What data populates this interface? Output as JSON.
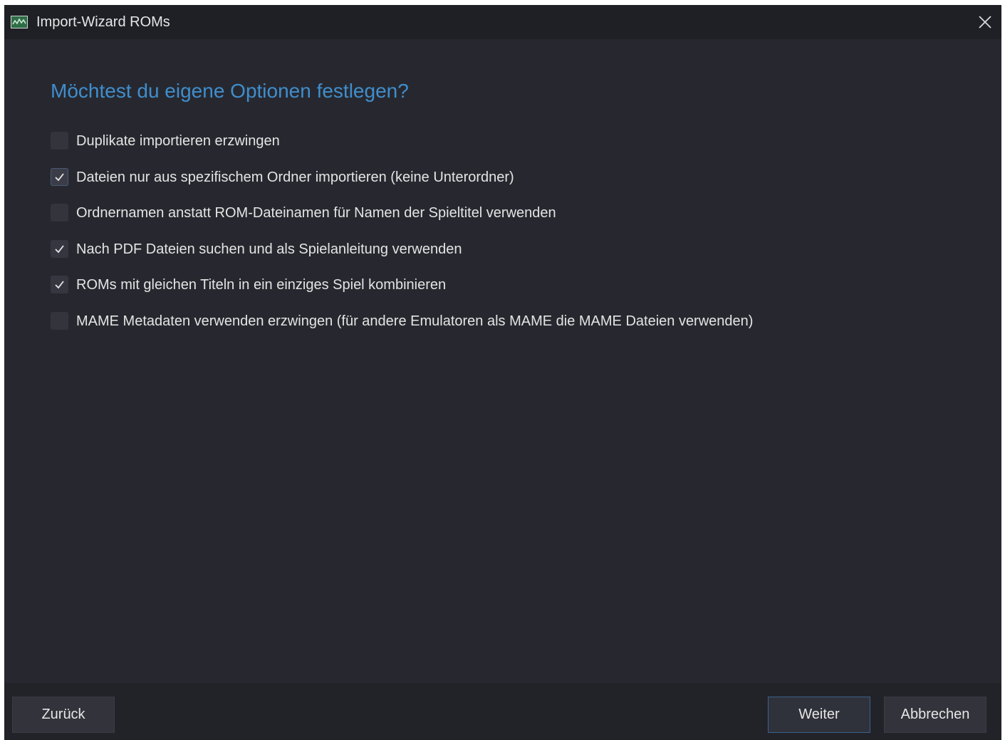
{
  "window": {
    "title": "Import-Wizard ROMs",
    "icon": "app-icon"
  },
  "page": {
    "heading": "Möchtest du eigene Optionen festlegen?"
  },
  "options": [
    {
      "label": "Duplikate importieren erzwingen",
      "checked": false
    },
    {
      "label": "Dateien nur aus spezifischem Ordner importieren (keine Unterordner)",
      "checked": true,
      "focused": true
    },
    {
      "label": "Ordnernamen anstatt ROM-Dateinamen für Namen der Spieltitel verwenden",
      "checked": false
    },
    {
      "label": "Nach PDF Dateien suchen und als Spielanleitung verwenden",
      "checked": true
    },
    {
      "label": "ROMs mit gleichen Titeln in ein einziges Spiel kombinieren",
      "checked": true
    },
    {
      "label": "MAME Metadaten verwenden erzwingen (für andere Emulatoren als MAME die MAME Dateien verwenden)",
      "checked": false
    }
  ],
  "footer": {
    "back_label": "Zurück",
    "next_label": "Weiter",
    "cancel_label": "Abbrechen"
  },
  "colors": {
    "background": "#27282f",
    "titlebar": "#1f2026",
    "heading": "#3f8ecd",
    "text": "#e4e4e4",
    "primary_border": "#3b5f8a"
  }
}
